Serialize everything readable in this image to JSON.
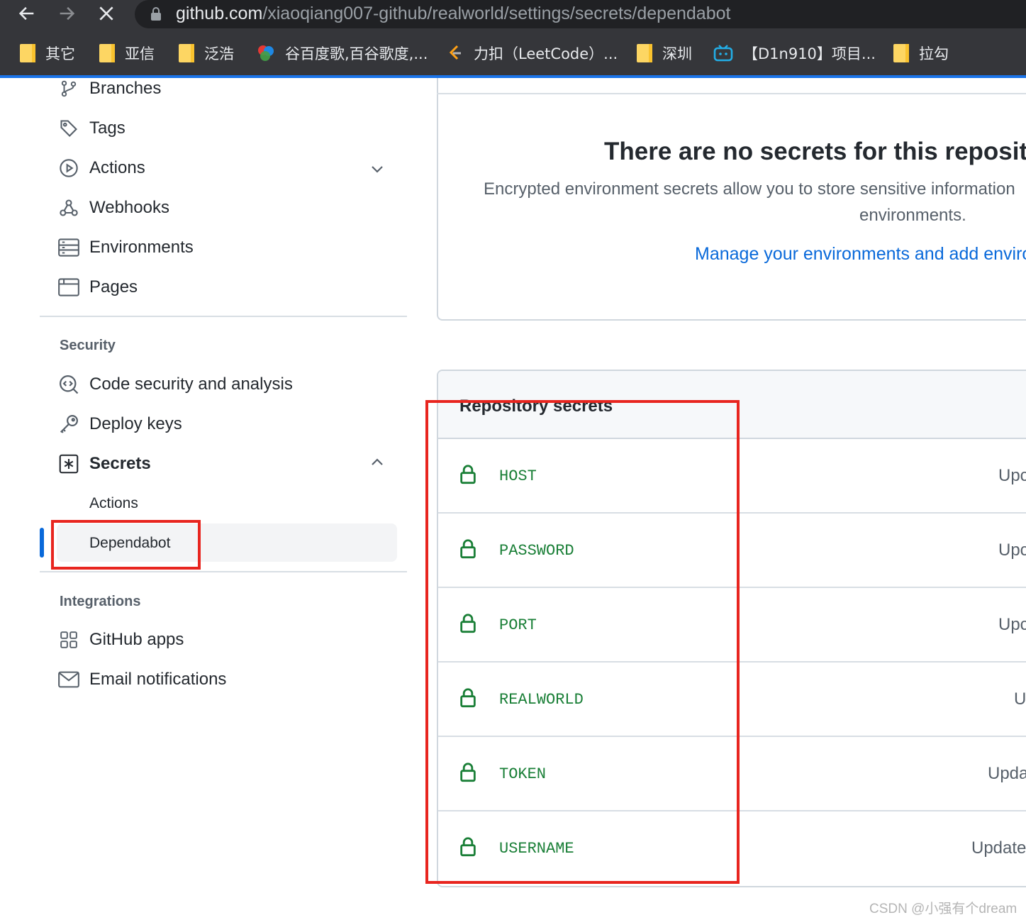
{
  "browser": {
    "url_host": "github.com",
    "url_path": "/xiaoqiang007-github/realworld/settings/secrets/dependabot",
    "bookmarks": [
      {
        "label": "其它",
        "icon": "folder-icon"
      },
      {
        "label": "亚信",
        "icon": "folder-icon"
      },
      {
        "label": "泛浩",
        "icon": "folder-icon"
      },
      {
        "label": "谷百度歌,百谷歌度,...",
        "icon": "colorful-balls-icon"
      },
      {
        "label": "力扣（LeetCode）...",
        "icon": "leetcode-icon"
      },
      {
        "label": "深圳",
        "icon": "folder-icon"
      },
      {
        "label": "【D1n910】项目...",
        "icon": "bilibili-icon"
      },
      {
        "label": "拉勾",
        "icon": "folder-icon"
      }
    ]
  },
  "sidebar": {
    "items": [
      {
        "label": "Branches",
        "icon": "git-branch-icon"
      },
      {
        "label": "Tags",
        "icon": "tag-icon"
      },
      {
        "label": "Actions",
        "icon": "play-circle-icon"
      },
      {
        "label": "Webhooks",
        "icon": "webhook-icon"
      },
      {
        "label": "Environments",
        "icon": "server-icon"
      },
      {
        "label": "Pages",
        "icon": "browser-icon"
      }
    ],
    "security_heading": "Security",
    "security_items": [
      {
        "label": "Code security and analysis",
        "icon": "codescan-icon"
      },
      {
        "label": "Deploy keys",
        "icon": "key-icon"
      },
      {
        "label": "Secrets",
        "icon": "asterisk-box-icon"
      }
    ],
    "secrets_sub": [
      "Actions",
      "Dependabot"
    ],
    "integrations_heading": "Integrations",
    "integration_items": [
      {
        "label": "GitHub apps",
        "icon": "apps-icon"
      },
      {
        "label": "Email notifications",
        "icon": "mail-icon"
      }
    ]
  },
  "environments": {
    "title": "There are no secrets for this repositor",
    "description": "Encrypted environment secrets allow you to store sensitive information",
    "description_line2": "environments.",
    "link": "Manage your environments and add enviro"
  },
  "repository_secrets": {
    "title": "Repository secrets",
    "rows": [
      {
        "name": "HOST",
        "updated": "Upc"
      },
      {
        "name": "PASSWORD",
        "updated": "Upc"
      },
      {
        "name": "PORT",
        "updated": "Upc"
      },
      {
        "name": "REALWORLD",
        "updated": "U"
      },
      {
        "name": "TOKEN",
        "updated": "Upda"
      },
      {
        "name": "USERNAME",
        "updated": "Update"
      }
    ]
  },
  "watermark": "CSDN @小强有个dream",
  "colors": {
    "accent": "#0969da",
    "secret_green": "#1a7f37",
    "annotation_red": "#e8251f"
  }
}
